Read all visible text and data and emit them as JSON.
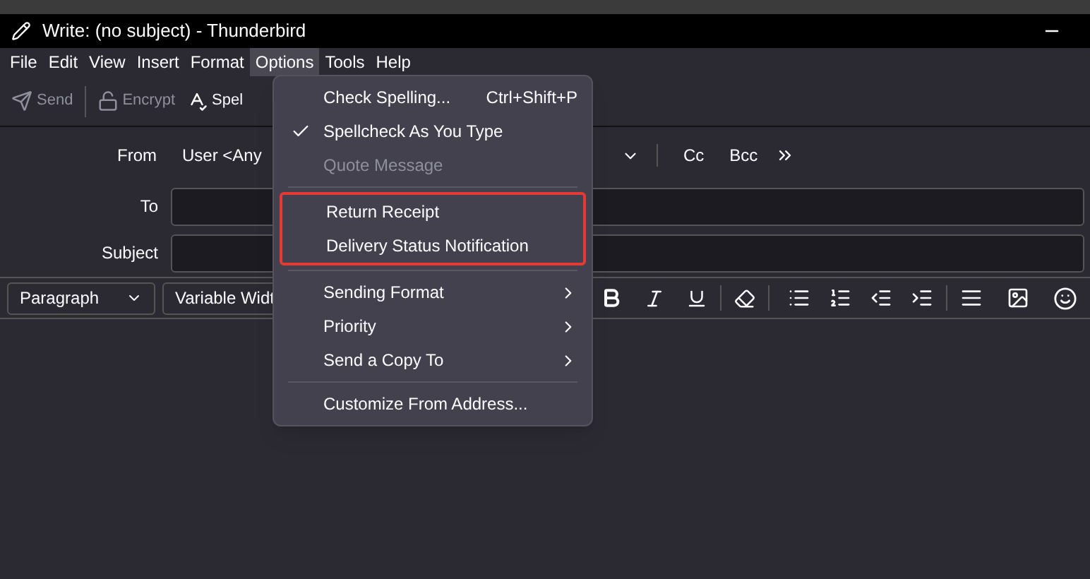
{
  "window": {
    "title": "Write: (no subject) - Thunderbird"
  },
  "menubar": [
    {
      "label": "File",
      "selected": false
    },
    {
      "label": "Edit",
      "selected": false
    },
    {
      "label": "View",
      "selected": false
    },
    {
      "label": "Insert",
      "selected": false
    },
    {
      "label": "Format",
      "selected": false
    },
    {
      "label": "Options",
      "selected": true
    },
    {
      "label": "Tools",
      "selected": false
    },
    {
      "label": "Help",
      "selected": false
    }
  ],
  "toolbar": [
    {
      "label": "Send",
      "kind": "send",
      "disabled": true
    },
    {
      "label": "Encrypt",
      "kind": "encrypt",
      "disabled": true
    },
    {
      "label": "Spel",
      "kind": "spelling",
      "disabled": false
    }
  ],
  "header": {
    "from_label": "From",
    "from_value": "User <Any",
    "to_label": "To",
    "subject_label": "Subject",
    "cc": "Cc",
    "bcc": "Bcc"
  },
  "format_toolbar": {
    "paragraph": "Paragraph",
    "font": "Variable Widt"
  },
  "menu": {
    "sections": [
      {
        "highlighted": false,
        "items": [
          {
            "label": "Check Spelling...",
            "shortcut": "Ctrl+Shift+P",
            "checked": false,
            "disabled": false,
            "submenu": false
          },
          {
            "label": "Spellcheck As You Type",
            "checked": true,
            "disabled": false,
            "submenu": false
          },
          {
            "label": "Quote Message",
            "checked": false,
            "disabled": true,
            "submenu": false
          }
        ]
      },
      {
        "highlighted": true,
        "items": [
          {
            "label": "Return Receipt",
            "checked": false,
            "disabled": false,
            "submenu": false
          },
          {
            "label": "Delivery Status Notification",
            "checked": false,
            "disabled": false,
            "submenu": false
          }
        ]
      },
      {
        "highlighted": false,
        "items": [
          {
            "label": "Sending Format",
            "checked": false,
            "disabled": false,
            "submenu": true
          },
          {
            "label": "Priority",
            "checked": false,
            "disabled": false,
            "submenu": true
          },
          {
            "label": "Send a Copy To",
            "checked": false,
            "disabled": false,
            "submenu": true
          }
        ]
      },
      {
        "highlighted": false,
        "items": [
          {
            "label": "Customize From Address...",
            "checked": false,
            "disabled": false,
            "submenu": false
          }
        ]
      }
    ]
  }
}
